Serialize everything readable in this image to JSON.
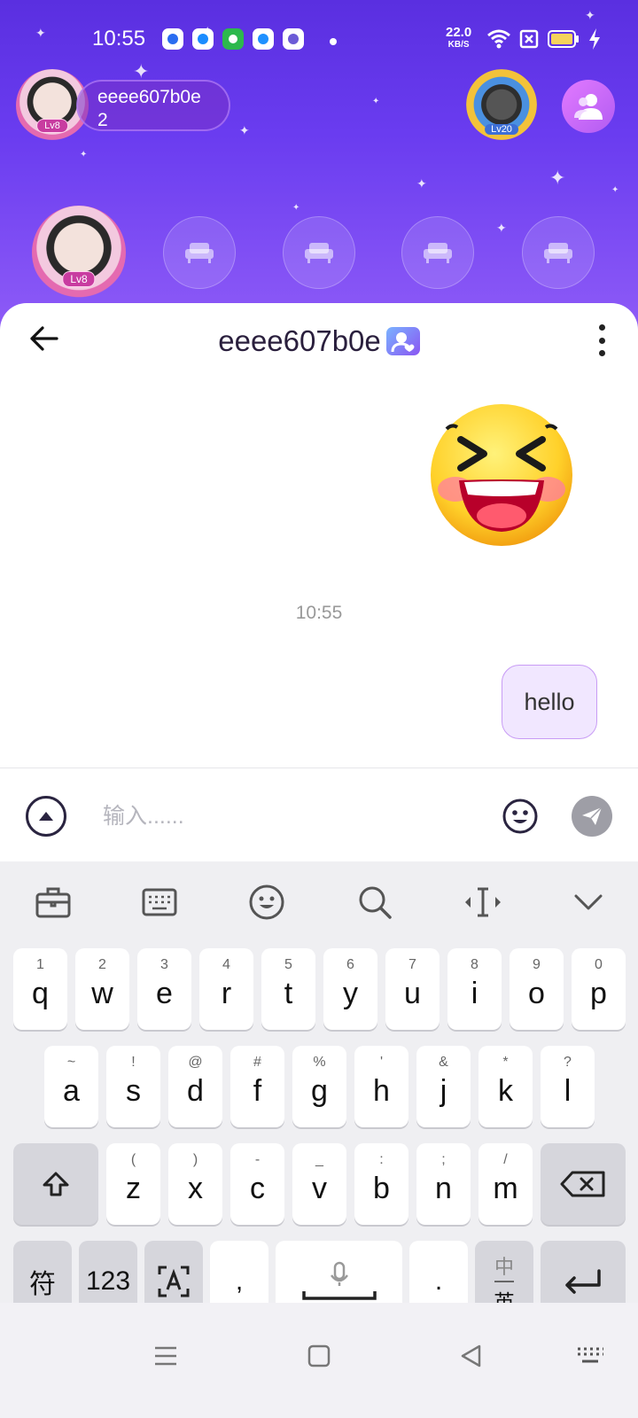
{
  "status_bar": {
    "time": "10:55",
    "net_speed_value": "22.0",
    "net_speed_unit": "KB/S",
    "icons": [
      "baidu-app-icon",
      "blue-app-icon",
      "green-app-icon",
      "qq-browser-icon",
      "purple-app-icon",
      "wifi-icon",
      "sim-icon",
      "battery-icon",
      "charging-icon"
    ]
  },
  "room": {
    "host_name": "eeee607b0e",
    "host_count": "2",
    "host_level": "Lv8",
    "guild_level": "Lv20",
    "seat_owner_level": "Lv8",
    "empty_seat_count": 4
  },
  "chat": {
    "title": "eeee607b0e",
    "timestamp": "10:55",
    "message_text": "hello",
    "input_placeholder": "输入......",
    "input_value": ""
  },
  "keyboard": {
    "toolbar_icons": [
      "briefcase-icon",
      "keyboard-icon",
      "emoji-icon",
      "search-icon",
      "cursor-icon",
      "collapse-icon"
    ],
    "row1": [
      {
        "s": "1",
        "m": "q"
      },
      {
        "s": "2",
        "m": "w"
      },
      {
        "s": "3",
        "m": "e"
      },
      {
        "s": "4",
        "m": "r"
      },
      {
        "s": "5",
        "m": "t"
      },
      {
        "s": "6",
        "m": "y"
      },
      {
        "s": "7",
        "m": "u"
      },
      {
        "s": "8",
        "m": "i"
      },
      {
        "s": "9",
        "m": "o"
      },
      {
        "s": "0",
        "m": "p"
      }
    ],
    "row2": [
      {
        "s": "~",
        "m": "a"
      },
      {
        "s": "!",
        "m": "s"
      },
      {
        "s": "@",
        "m": "d"
      },
      {
        "s": "#",
        "m": "f"
      },
      {
        "s": "%",
        "m": "g"
      },
      {
        "s": "'",
        "m": "h"
      },
      {
        "s": "&",
        "m": "j"
      },
      {
        "s": "*",
        "m": "k"
      },
      {
        "s": "?",
        "m": "l"
      }
    ],
    "row3": [
      {
        "s": "(",
        "m": "z"
      },
      {
        "s": ")",
        "m": "x"
      },
      {
        "s": "-",
        "m": "c"
      },
      {
        "s": "_",
        "m": "v"
      },
      {
        "s": ":",
        "m": "b"
      },
      {
        "s": ";",
        "m": "n"
      },
      {
        "s": "/",
        "m": "m"
      }
    ],
    "symbols_label": "符",
    "numbers_label": "123",
    "comma_label": ",",
    "period_label": ".",
    "lang_top": "中",
    "lang_bottom": "英"
  },
  "colors": {
    "accent": "#6a3cf0",
    "bubble_bg": "#f1e7ff",
    "bubble_border": "#c89cf5"
  }
}
